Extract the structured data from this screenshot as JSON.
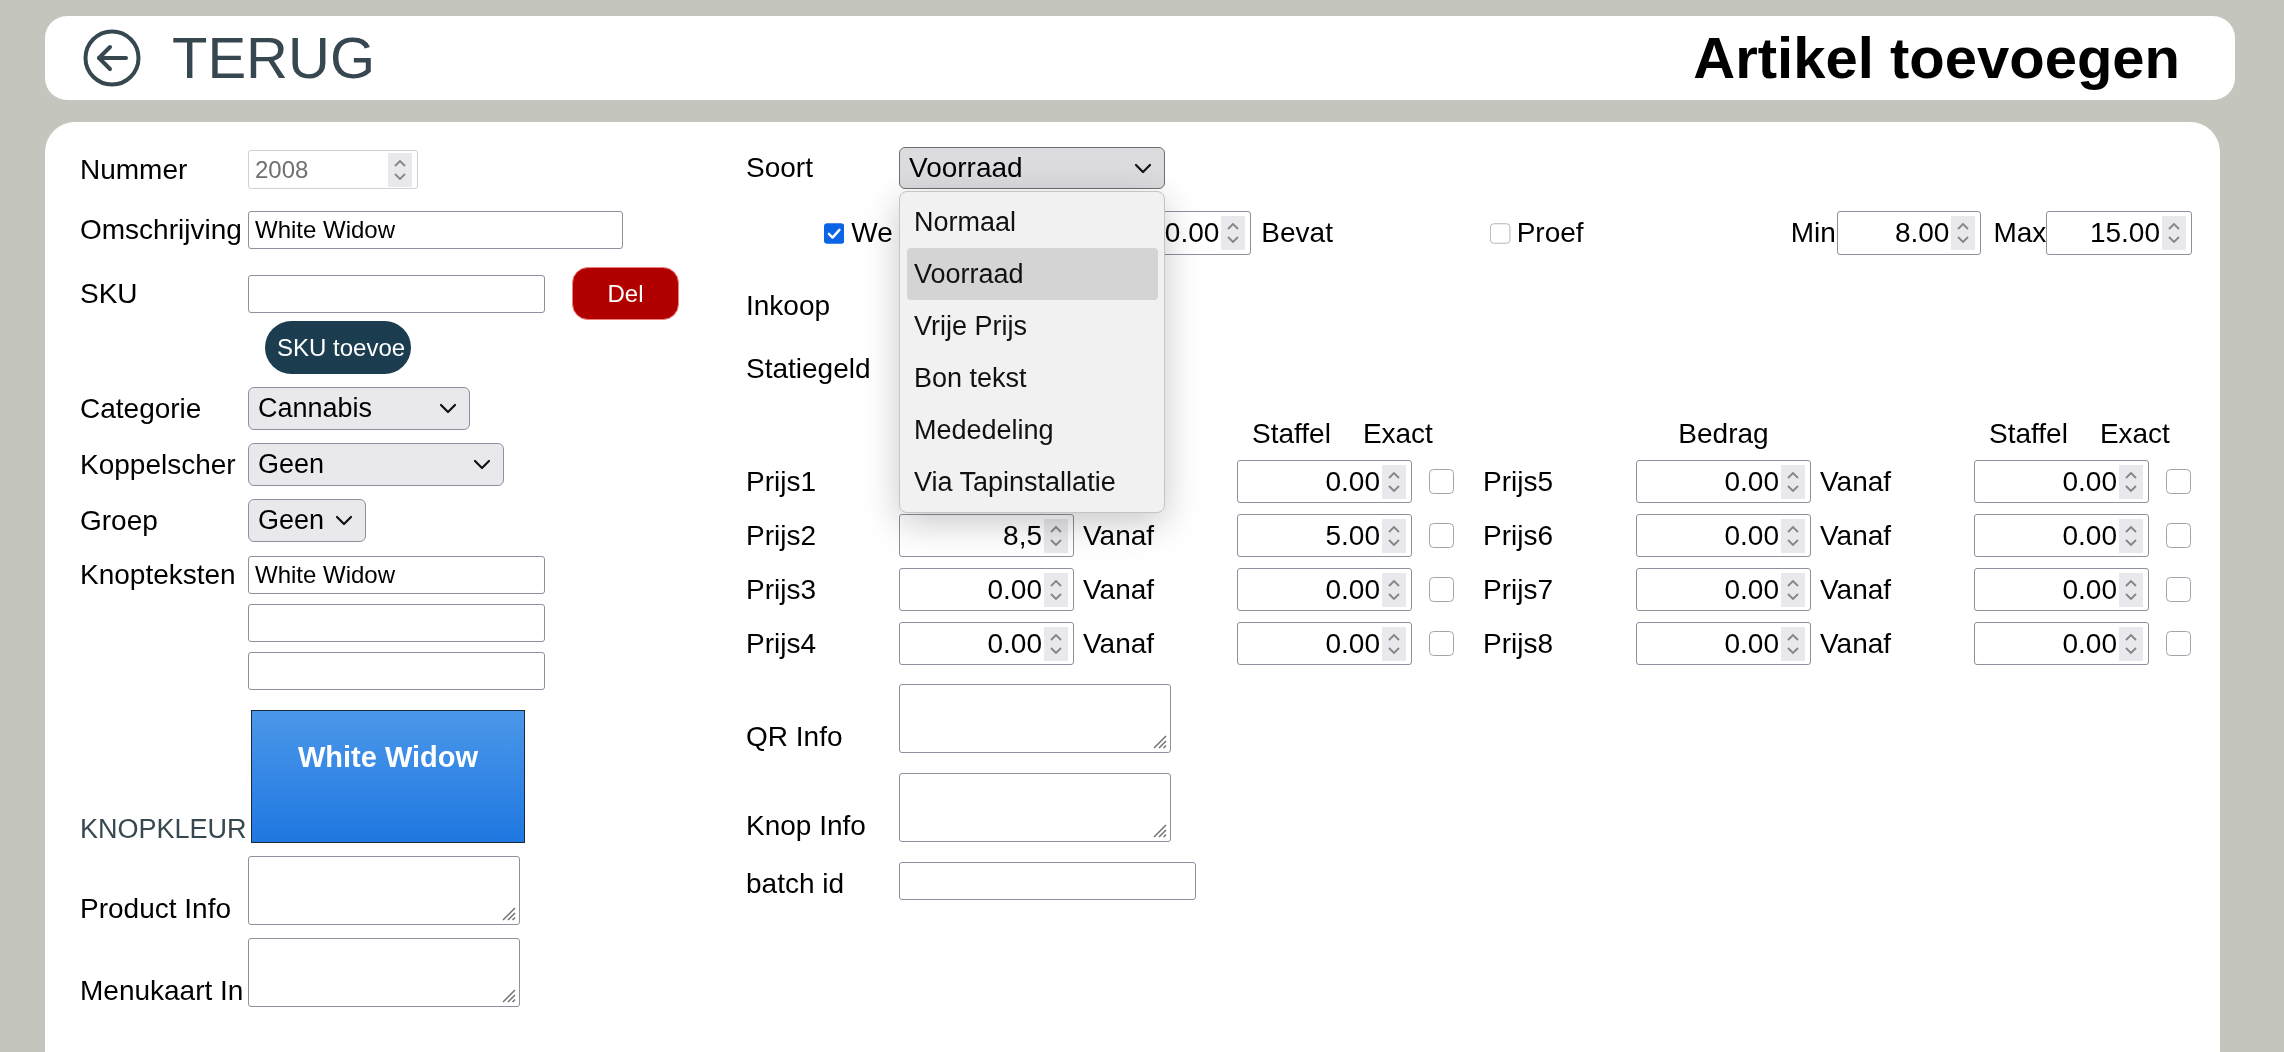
{
  "header": {
    "back_label": "TERUG",
    "title": "Artikel toevoegen"
  },
  "left_fields": [
    {
      "kind": "number",
      "label": "Nummer",
      "value": "2008",
      "disabled": true
    },
    {
      "kind": "text",
      "label": "Omschrijving",
      "value": "White Widow"
    },
    {
      "kind": "sku",
      "label": "SKU",
      "delete_button": "Del",
      "add_button": "SKU toevoe"
    },
    {
      "kind": "select",
      "label": "Categorie",
      "value": "Cannabis"
    },
    {
      "kind": "select",
      "label": "Koppelscher",
      "value": "Geen"
    },
    {
      "kind": "select",
      "label": "Groep",
      "value": "Geen"
    },
    {
      "kind": "multi_text",
      "label": "Knopteksten",
      "lines": [
        {
          "kind": "filled",
          "value": "White Widow"
        },
        {
          "kind": "blank"
        },
        {
          "kind": "blank"
        }
      ]
    },
    {
      "kind": "color",
      "label": "KNOPKLEUR",
      "preview": "White Widow"
    },
    {
      "kind": "textarea",
      "label": "Product Info"
    },
    {
      "kind": "textarea",
      "label": "Menukaart In"
    }
  ],
  "soort": {
    "label": "Soort",
    "value": "Voorraad",
    "expanded": true,
    "options": [
      {
        "label": "Normaal",
        "selected": false
      },
      {
        "label": "Voorraad",
        "selected": true
      },
      {
        "label": "Vrije Prijs",
        "selected": false
      },
      {
        "label": "Bon tekst",
        "selected": false
      },
      {
        "label": "Mededeling",
        "selected": false
      },
      {
        "label": "Via Tapinstallatie",
        "selected": false
      }
    ]
  },
  "options_row": {
    "weight": {
      "label": "We",
      "checked": true,
      "value": "0.00"
    },
    "contains_label": "Bevat",
    "proef": {
      "label": "Proef",
      "checked": false
    },
    "min": {
      "label": "Min",
      "value": "8.00"
    },
    "max": {
      "label": "Max",
      "value": "15.00"
    }
  },
  "extra_labels": [
    "Inkoop",
    "Statiegeld"
  ],
  "price_groups": [
    {
      "headers": {
        "staffel": "Staffel",
        "exact": "Exact"
      },
      "rows": [
        {
          "label": "Prijs1",
          "staffel": "0.00",
          "exact": false
        },
        {
          "label": "Prijs2",
          "amount": "8,5",
          "from": "Vanaf",
          "staffel": "5.00",
          "exact": false
        },
        {
          "label": "Prijs3",
          "amount": "0.00",
          "from": "Vanaf",
          "staffel": "0.00",
          "exact": false
        },
        {
          "label": "Prijs4",
          "amount": "0.00",
          "from": "Vanaf",
          "staffel": "0.00",
          "exact": false
        }
      ]
    },
    {
      "headers": {
        "amount": "Bedrag",
        "staffel": "Staffel",
        "exact": "Exact"
      },
      "rows": [
        {
          "label": "Prijs5",
          "amount": "0.00",
          "from": "Vanaf",
          "staffel": "0.00",
          "exact": false
        },
        {
          "label": "Prijs6",
          "amount": "0.00",
          "from": "Vanaf",
          "staffel": "0.00",
          "exact": false
        },
        {
          "label": "Prijs7",
          "amount": "0.00",
          "from": "Vanaf",
          "staffel": "0.00",
          "exact": false
        },
        {
          "label": "Prijs8",
          "amount": "0.00",
          "from": "Vanaf",
          "staffel": "0.00",
          "exact": false
        }
      ]
    }
  ],
  "info_fields": [
    {
      "kind": "textarea",
      "label": "QR Info"
    },
    {
      "kind": "textarea",
      "label": "Knop Info"
    },
    {
      "kind": "text",
      "label": "batch id"
    }
  ]
}
